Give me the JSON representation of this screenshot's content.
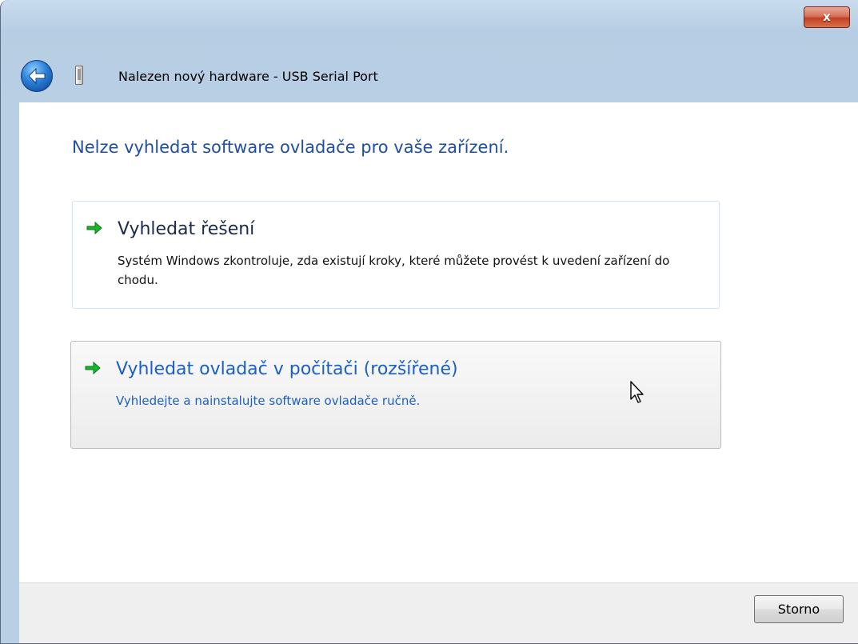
{
  "window": {
    "close_label": "x",
    "title": "Nalezen nový hardware - USB Serial Port"
  },
  "content": {
    "heading": "Nelze vyhledat software ovladače pro vaše zařízení.",
    "options": [
      {
        "title": "Vyhledat řešení",
        "description": "Systém Windows zkontroluje, zda existují kroky, které můžete provést k uvedení zařízení do chodu."
      },
      {
        "title": "Vyhledat ovladač v počítači (rozšířené)",
        "description": "Vyhledejte a nainstalujte software ovladače ručně."
      }
    ]
  },
  "footer": {
    "cancel_label": "Storno"
  },
  "colors": {
    "heading": "#1e4fa5",
    "link": "#1c5fc4",
    "arrow": "#17b52b",
    "close_button": "#c23f22"
  },
  "icons": {
    "back": "back-arrow-icon",
    "device": "usb-device-icon",
    "option_arrow": "green-arrow-icon",
    "cursor": "mouse-pointer-icon"
  }
}
